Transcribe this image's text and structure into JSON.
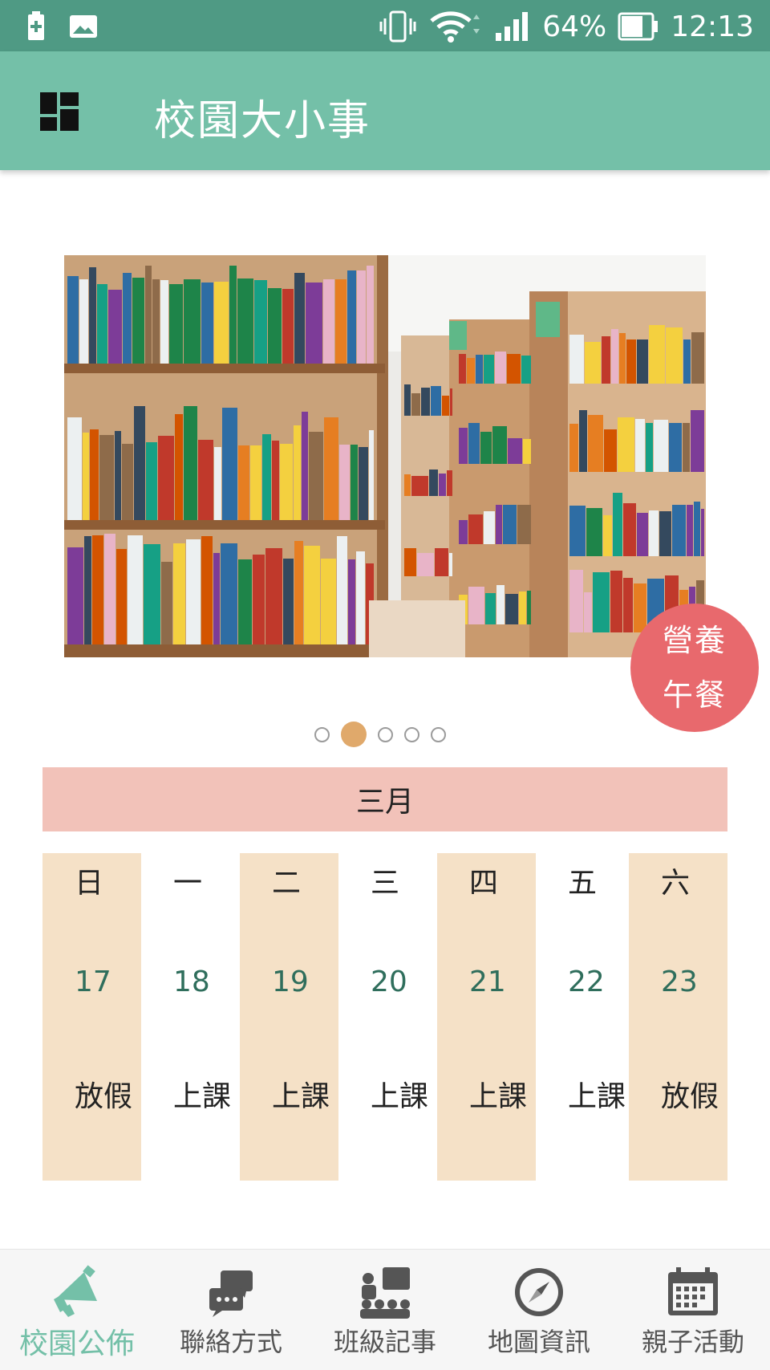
{
  "status_bar": {
    "battery_percent": "64%",
    "time": "12:13",
    "icons": [
      "battery-charging-icon",
      "image-icon",
      "vibrate-icon",
      "wifi-icon",
      "signal-icon",
      "battery-icon"
    ]
  },
  "app_bar": {
    "title": "校園大小事",
    "menu_icon": "dashboard-icon"
  },
  "banner": {
    "image": "library-bookshelves-photo",
    "badge_line1": "營養",
    "badge_line2": "午餐",
    "carousel_pages": 5,
    "carousel_active_index": 1
  },
  "calendar": {
    "month": "三月",
    "days": [
      {
        "weekday": "日",
        "date": "17",
        "status": "放假"
      },
      {
        "weekday": "一",
        "date": "18",
        "status": "上課"
      },
      {
        "weekday": "二",
        "date": "19",
        "status": "上課"
      },
      {
        "weekday": "三",
        "date": "20",
        "status": "上課"
      },
      {
        "weekday": "四",
        "date": "21",
        "status": "上課"
      },
      {
        "weekday": "五",
        "date": "22",
        "status": "上課"
      },
      {
        "weekday": "六",
        "date": "23",
        "status": "放假"
      }
    ]
  },
  "bottom_nav": {
    "items": [
      {
        "label": "校園公佈",
        "icon": "megaphone-icon",
        "active": true
      },
      {
        "label": "聯絡方式",
        "icon": "chat-icon",
        "active": false
      },
      {
        "label": "班級記事",
        "icon": "class-icon",
        "active": false
      },
      {
        "label": "地圖資訊",
        "icon": "compass-icon",
        "active": false
      },
      {
        "label": "親子活動",
        "icon": "calendar-icon",
        "active": false
      }
    ]
  },
  "colors": {
    "status_bar": "#4f9a84",
    "app_bar": "#74c0a8",
    "badge": "#e8696d",
    "month_header": "#f2c2b9",
    "day_column_shade": "#f5e1c7",
    "date_text": "#2f6e5c",
    "active_nav": "#74c0a8"
  }
}
